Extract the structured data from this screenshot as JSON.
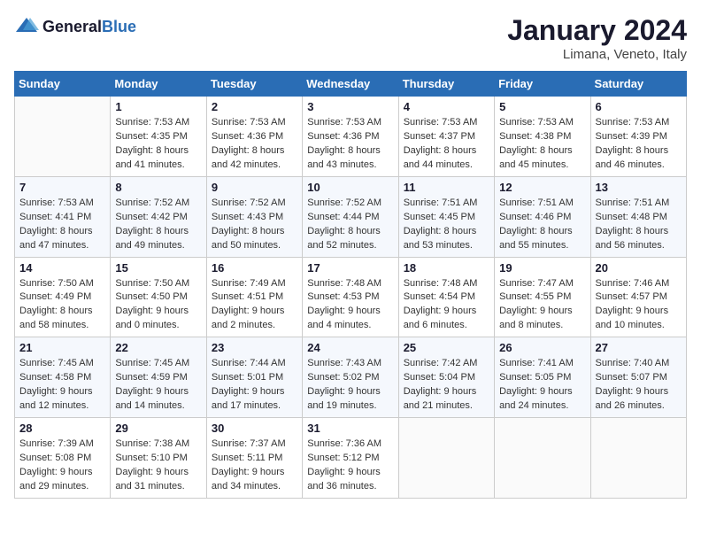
{
  "logo": {
    "general": "General",
    "blue": "Blue"
  },
  "title": "January 2024",
  "location": "Limana, Veneto, Italy",
  "days_of_week": [
    "Sunday",
    "Monday",
    "Tuesday",
    "Wednesday",
    "Thursday",
    "Friday",
    "Saturday"
  ],
  "weeks": [
    [
      {
        "num": "",
        "sunrise": "",
        "sunset": "",
        "daylight": ""
      },
      {
        "num": "1",
        "sunrise": "Sunrise: 7:53 AM",
        "sunset": "Sunset: 4:35 PM",
        "daylight": "Daylight: 8 hours and 41 minutes."
      },
      {
        "num": "2",
        "sunrise": "Sunrise: 7:53 AM",
        "sunset": "Sunset: 4:36 PM",
        "daylight": "Daylight: 8 hours and 42 minutes."
      },
      {
        "num": "3",
        "sunrise": "Sunrise: 7:53 AM",
        "sunset": "Sunset: 4:36 PM",
        "daylight": "Daylight: 8 hours and 43 minutes."
      },
      {
        "num": "4",
        "sunrise": "Sunrise: 7:53 AM",
        "sunset": "Sunset: 4:37 PM",
        "daylight": "Daylight: 8 hours and 44 minutes."
      },
      {
        "num": "5",
        "sunrise": "Sunrise: 7:53 AM",
        "sunset": "Sunset: 4:38 PM",
        "daylight": "Daylight: 8 hours and 45 minutes."
      },
      {
        "num": "6",
        "sunrise": "Sunrise: 7:53 AM",
        "sunset": "Sunset: 4:39 PM",
        "daylight": "Daylight: 8 hours and 46 minutes."
      }
    ],
    [
      {
        "num": "7",
        "sunrise": "Sunrise: 7:53 AM",
        "sunset": "Sunset: 4:41 PM",
        "daylight": "Daylight: 8 hours and 47 minutes."
      },
      {
        "num": "8",
        "sunrise": "Sunrise: 7:52 AM",
        "sunset": "Sunset: 4:42 PM",
        "daylight": "Daylight: 8 hours and 49 minutes."
      },
      {
        "num": "9",
        "sunrise": "Sunrise: 7:52 AM",
        "sunset": "Sunset: 4:43 PM",
        "daylight": "Daylight: 8 hours and 50 minutes."
      },
      {
        "num": "10",
        "sunrise": "Sunrise: 7:52 AM",
        "sunset": "Sunset: 4:44 PM",
        "daylight": "Daylight: 8 hours and 52 minutes."
      },
      {
        "num": "11",
        "sunrise": "Sunrise: 7:51 AM",
        "sunset": "Sunset: 4:45 PM",
        "daylight": "Daylight: 8 hours and 53 minutes."
      },
      {
        "num": "12",
        "sunrise": "Sunrise: 7:51 AM",
        "sunset": "Sunset: 4:46 PM",
        "daylight": "Daylight: 8 hours and 55 minutes."
      },
      {
        "num": "13",
        "sunrise": "Sunrise: 7:51 AM",
        "sunset": "Sunset: 4:48 PM",
        "daylight": "Daylight: 8 hours and 56 minutes."
      }
    ],
    [
      {
        "num": "14",
        "sunrise": "Sunrise: 7:50 AM",
        "sunset": "Sunset: 4:49 PM",
        "daylight": "Daylight: 8 hours and 58 minutes."
      },
      {
        "num": "15",
        "sunrise": "Sunrise: 7:50 AM",
        "sunset": "Sunset: 4:50 PM",
        "daylight": "Daylight: 9 hours and 0 minutes."
      },
      {
        "num": "16",
        "sunrise": "Sunrise: 7:49 AM",
        "sunset": "Sunset: 4:51 PM",
        "daylight": "Daylight: 9 hours and 2 minutes."
      },
      {
        "num": "17",
        "sunrise": "Sunrise: 7:48 AM",
        "sunset": "Sunset: 4:53 PM",
        "daylight": "Daylight: 9 hours and 4 minutes."
      },
      {
        "num": "18",
        "sunrise": "Sunrise: 7:48 AM",
        "sunset": "Sunset: 4:54 PM",
        "daylight": "Daylight: 9 hours and 6 minutes."
      },
      {
        "num": "19",
        "sunrise": "Sunrise: 7:47 AM",
        "sunset": "Sunset: 4:55 PM",
        "daylight": "Daylight: 9 hours and 8 minutes."
      },
      {
        "num": "20",
        "sunrise": "Sunrise: 7:46 AM",
        "sunset": "Sunset: 4:57 PM",
        "daylight": "Daylight: 9 hours and 10 minutes."
      }
    ],
    [
      {
        "num": "21",
        "sunrise": "Sunrise: 7:45 AM",
        "sunset": "Sunset: 4:58 PM",
        "daylight": "Daylight: 9 hours and 12 minutes."
      },
      {
        "num": "22",
        "sunrise": "Sunrise: 7:45 AM",
        "sunset": "Sunset: 4:59 PM",
        "daylight": "Daylight: 9 hours and 14 minutes."
      },
      {
        "num": "23",
        "sunrise": "Sunrise: 7:44 AM",
        "sunset": "Sunset: 5:01 PM",
        "daylight": "Daylight: 9 hours and 17 minutes."
      },
      {
        "num": "24",
        "sunrise": "Sunrise: 7:43 AM",
        "sunset": "Sunset: 5:02 PM",
        "daylight": "Daylight: 9 hours and 19 minutes."
      },
      {
        "num": "25",
        "sunrise": "Sunrise: 7:42 AM",
        "sunset": "Sunset: 5:04 PM",
        "daylight": "Daylight: 9 hours and 21 minutes."
      },
      {
        "num": "26",
        "sunrise": "Sunrise: 7:41 AM",
        "sunset": "Sunset: 5:05 PM",
        "daylight": "Daylight: 9 hours and 24 minutes."
      },
      {
        "num": "27",
        "sunrise": "Sunrise: 7:40 AM",
        "sunset": "Sunset: 5:07 PM",
        "daylight": "Daylight: 9 hours and 26 minutes."
      }
    ],
    [
      {
        "num": "28",
        "sunrise": "Sunrise: 7:39 AM",
        "sunset": "Sunset: 5:08 PM",
        "daylight": "Daylight: 9 hours and 29 minutes."
      },
      {
        "num": "29",
        "sunrise": "Sunrise: 7:38 AM",
        "sunset": "Sunset: 5:10 PM",
        "daylight": "Daylight: 9 hours and 31 minutes."
      },
      {
        "num": "30",
        "sunrise": "Sunrise: 7:37 AM",
        "sunset": "Sunset: 5:11 PM",
        "daylight": "Daylight: 9 hours and 34 minutes."
      },
      {
        "num": "31",
        "sunrise": "Sunrise: 7:36 AM",
        "sunset": "Sunset: 5:12 PM",
        "daylight": "Daylight: 9 hours and 36 minutes."
      },
      {
        "num": "",
        "sunrise": "",
        "sunset": "",
        "daylight": ""
      },
      {
        "num": "",
        "sunrise": "",
        "sunset": "",
        "daylight": ""
      },
      {
        "num": "",
        "sunrise": "",
        "sunset": "",
        "daylight": ""
      }
    ]
  ]
}
